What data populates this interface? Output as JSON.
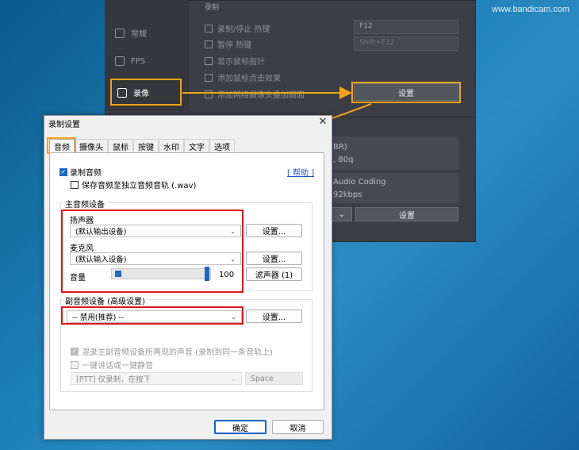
{
  "watermark": "www.bandicam.com",
  "background_window": {
    "nav": [
      {
        "label": "常规",
        "icon": "gear-icon"
      },
      {
        "label": "FPS",
        "icon": "fps-icon"
      },
      {
        "label": "录像",
        "icon": "video-icon",
        "selected": true
      }
    ],
    "section_heading": "录制",
    "options": [
      "录制/停止 热键",
      "暂停 热键",
      "显示鼠标指针",
      "添加鼠标点击效果",
      "添加网络摄像头叠加画面"
    ],
    "hotkey_value": "F12",
    "hotkey2_value": "Shift+F12",
    "settings_label": "设置",
    "format_line1": "BR)",
    "format_line2": ", 80q",
    "format_line3": "Audio Coding",
    "format_line4": "92kbps",
    "settings2_label": "设置",
    "chevron": "⌄"
  },
  "dialog": {
    "title": "录制设置",
    "close": "✕",
    "tabs": [
      "音频",
      "摄像头",
      "鼠标",
      "按键",
      "水印",
      "文字",
      "选项"
    ],
    "active_tab": 0,
    "record_audio_label": "录制音频",
    "record_audio_checked": true,
    "save_separate_label": "保存音频至独立音频音轨 (.wav)",
    "save_separate_checked": false,
    "help_link": "[ 帮助 ]",
    "primary_group": "主音频设备",
    "speaker_label": "扬声器",
    "speaker_value": "(默认输出设备)",
    "speaker_settings": "设置...",
    "mic_label": "麦克风",
    "mic_value": "(默认输入设备)",
    "mic_settings": "设置...",
    "volume_label": "音量",
    "volume_value": "100",
    "volume_level": 1.0,
    "filter_button": "滤声器 (1)",
    "secondary_group": "副音频设备 (高级设置)",
    "secondary_value": "-- 禁用(推荐) --",
    "secondary_settings": "设置...",
    "mix_label": "混录主副音频设备所再现的声音 (录制到同一条音轨上)",
    "mix_checked": true,
    "ptt_label": "一键讲话或一键静音",
    "ptt_checked": false,
    "ptt_mode_value": "[PTT] 仅录制，在按下",
    "ptt_key_value": "Space",
    "ok_label": "确定",
    "cancel_label": "取消"
  },
  "colors": {
    "highlight_orange": "#f3a21a",
    "highlight_red": "#e0161e",
    "accent_blue": "#1d68c4"
  }
}
